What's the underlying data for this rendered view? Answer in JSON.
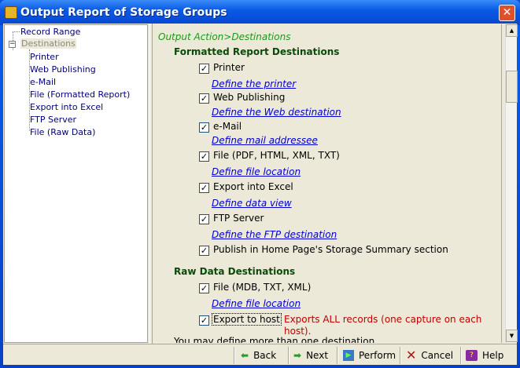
{
  "window": {
    "title": "Output Report of Storage Groups",
    "close_icon": "close-icon"
  },
  "tree": {
    "items": [
      {
        "label": "Record Range",
        "level": 0
      },
      {
        "label": "Destinations",
        "level": 0,
        "expanded": true,
        "selected": true
      },
      {
        "label": "Printer",
        "level": 1
      },
      {
        "label": "Web Publishing",
        "level": 1
      },
      {
        "label": "e-Mail",
        "level": 1
      },
      {
        "label": "File (Formatted Report)",
        "level": 1
      },
      {
        "label": "Export into Excel",
        "level": 1
      },
      {
        "label": "FTP Server",
        "level": 1
      },
      {
        "label": "File (Raw Data)",
        "level": 1
      }
    ]
  },
  "main": {
    "breadcrumb": "Output Action>Destinations",
    "formatted_header": "Formatted Report Destinations",
    "formatted": [
      {
        "label": "Printer",
        "checked": true,
        "link": "Define the printer"
      },
      {
        "label": "Web Publishing",
        "checked": true,
        "link": "Define the Web destination"
      },
      {
        "label": "e-Mail",
        "checked": true,
        "link": "Define mail addressee"
      },
      {
        "label": "File (PDF, HTML, XML, TXT)",
        "checked": true,
        "link": "Define file location"
      },
      {
        "label": "Export into Excel",
        "checked": true,
        "link": "Define data view"
      },
      {
        "label": "FTP Server",
        "checked": true,
        "link": "Define the FTP destination"
      },
      {
        "label": "Publish in Home Page's Storage Summary section",
        "checked": true
      }
    ],
    "raw_header": "Raw Data Destinations",
    "raw": [
      {
        "label": "File (MDB, TXT, XML)",
        "checked": true,
        "link": "Define file location"
      },
      {
        "label": "Export to host",
        "checked": true,
        "note_line1": "Exports ALL records (one capture on each",
        "note_line2": "host)."
      }
    ],
    "footer_note": "You may define more than one destination"
  },
  "toolbar": {
    "back": "Back",
    "next": "Next",
    "perform": "Perform",
    "cancel": "Cancel",
    "help": "Help"
  },
  "colors": {
    "title_bar": "#0a5ae6",
    "breadcrumb": "#1a9a1a",
    "header": "#0a4a0a",
    "link": "#0000d0",
    "warning": "#c00000"
  }
}
